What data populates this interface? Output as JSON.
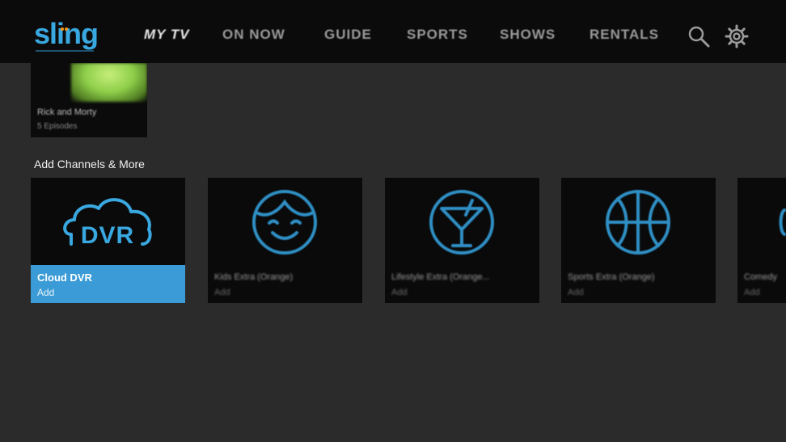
{
  "header": {
    "logo": "sling",
    "nav": [
      {
        "label": "MY TV",
        "active": true
      },
      {
        "label": "ON NOW",
        "active": false
      },
      {
        "label": "GUIDE",
        "active": false
      },
      {
        "label": "SPORTS",
        "active": false
      },
      {
        "label": "SHOWS",
        "active": false
      },
      {
        "label": "RENTALS",
        "active": false
      }
    ],
    "icons": [
      "search-icon",
      "gear-icon"
    ]
  },
  "recent": {
    "title": "Rick and Morty",
    "subtitle": "5 Episodes"
  },
  "add_channels": {
    "section_title": "Add Channels & More",
    "tiles": [
      {
        "icon": "dvr-cloud-icon",
        "icon_text": "DVR",
        "name": "Cloud DVR",
        "action": "Add",
        "focused": true
      },
      {
        "icon": "kids-face-icon",
        "name": "Kids Extra (Orange)",
        "action": "Add",
        "focused": false
      },
      {
        "icon": "cocktail-icon",
        "name": "Lifestyle Extra (Orange...",
        "action": "Add",
        "focused": false
      },
      {
        "icon": "basketball-icon",
        "name": "Sports Extra (Orange)",
        "action": "Add",
        "focused": false
      },
      {
        "icon": "comedy-icon",
        "name": "Comedy",
        "action": "Add",
        "focused": false
      }
    ]
  },
  "colors": {
    "accent": "#3aa8e0",
    "focus": "#3b9bd6",
    "background": "#2b2b2b",
    "header": "#0b0b0b"
  }
}
